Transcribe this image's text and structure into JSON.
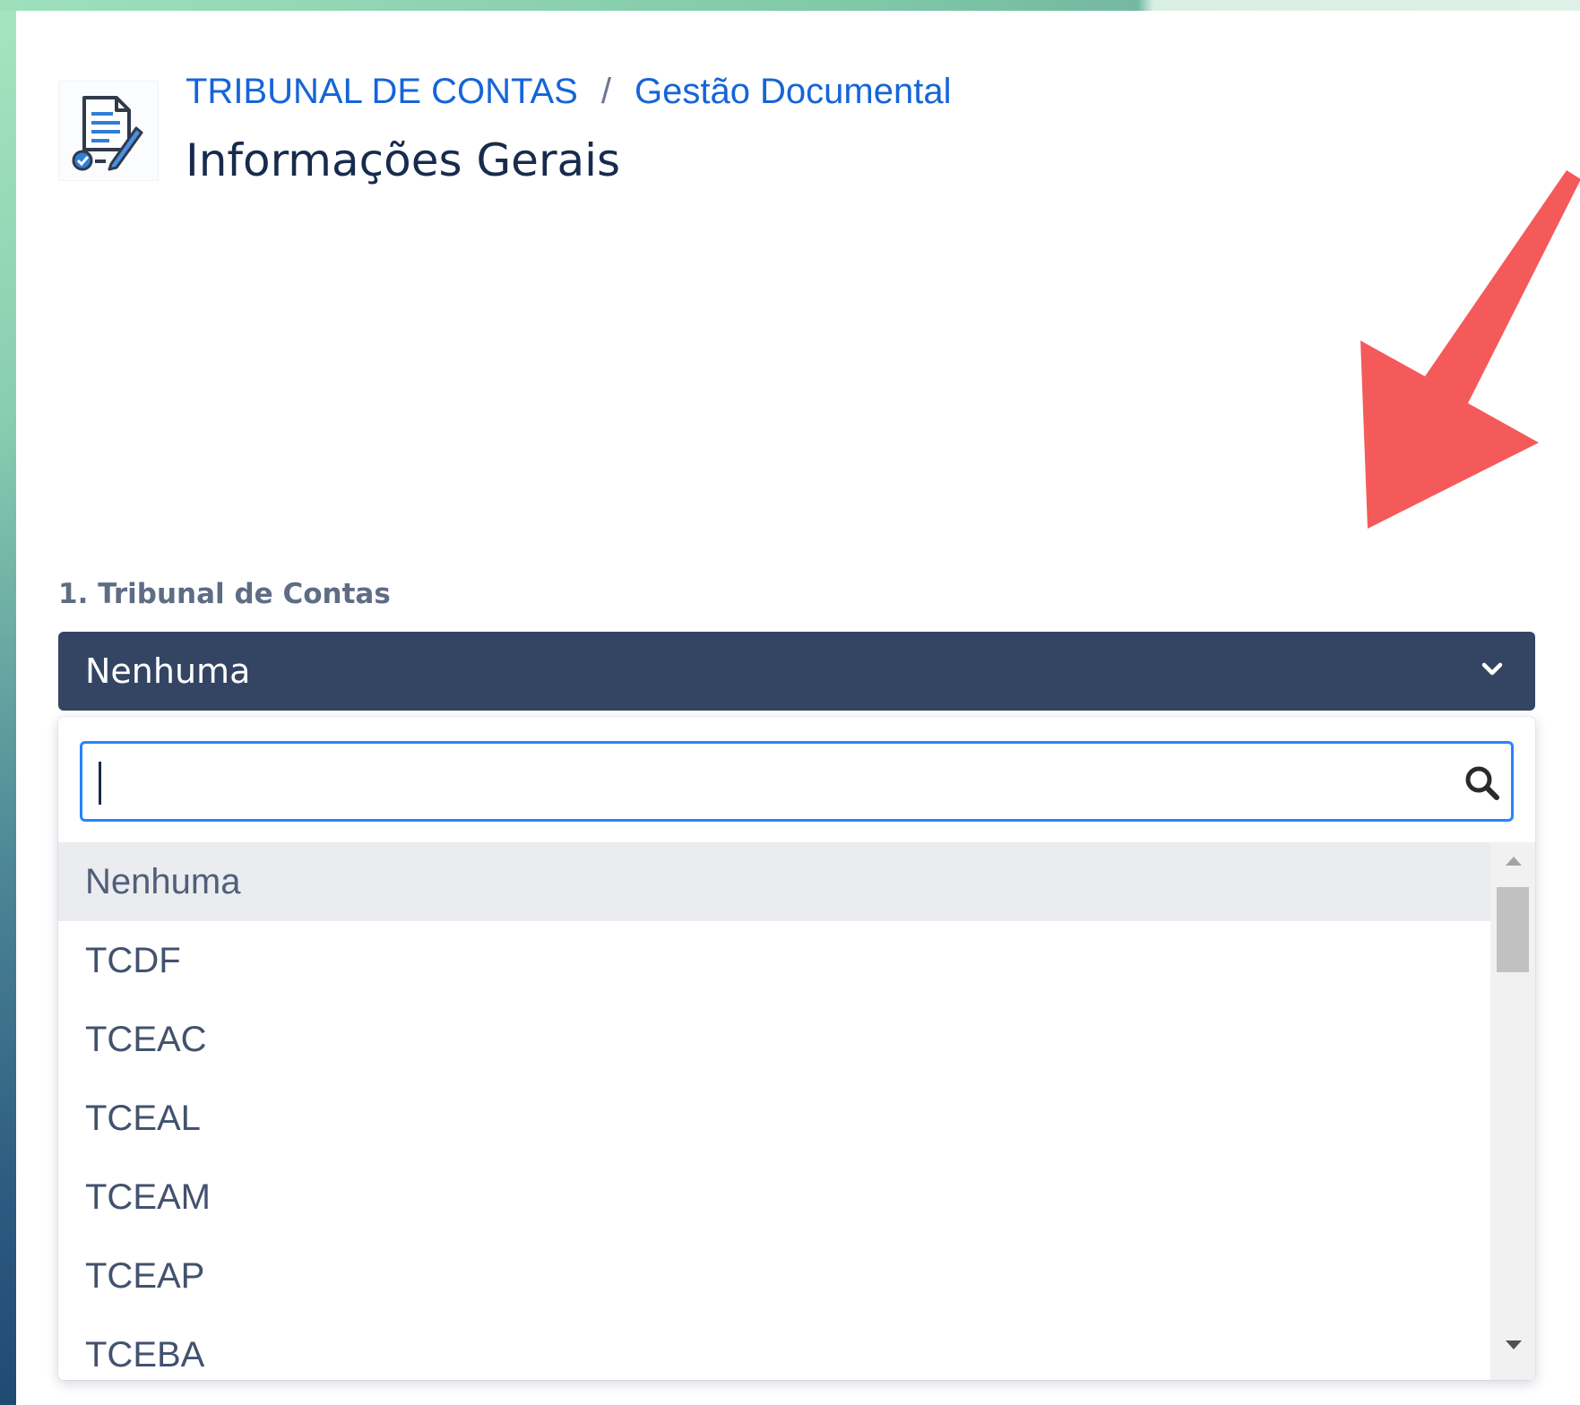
{
  "header": {
    "breadcrumb": [
      "TRIBUNAL DE CONTAS",
      "Gestão Documental"
    ],
    "breadcrumb_separator": "/",
    "title": "Informações Gerais",
    "logo_icon": "document-signature-icon"
  },
  "form": {
    "field_label": "1. Tribunal de Contas",
    "selected_value": "Nenhuma",
    "search": {
      "value": "",
      "placeholder": ""
    },
    "options": [
      "Nenhuma",
      "TCDF",
      "TCEAC",
      "TCEAL",
      "TCEAM",
      "TCEAP",
      "TCEBA"
    ],
    "highlighted_option": "Nenhuma"
  },
  "colors": {
    "accent": "#2684ff",
    "link": "#1565d8",
    "select_bg": "#344563",
    "annotation_arrow": "#f55a5a"
  }
}
